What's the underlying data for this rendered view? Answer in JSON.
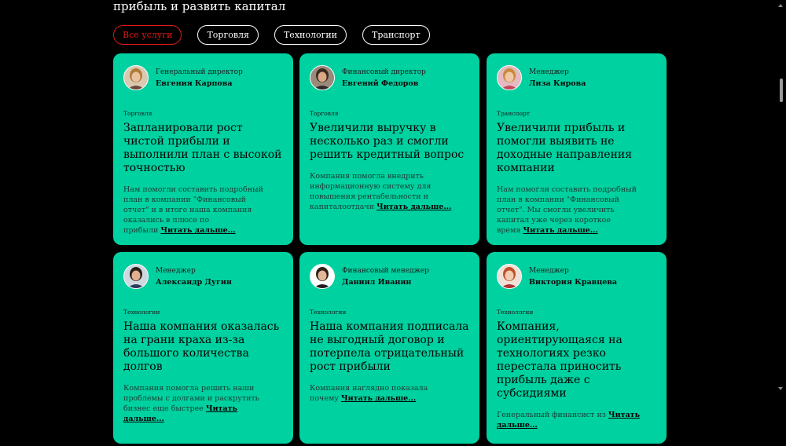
{
  "header": {
    "subtitle": "прибыль и развить капитал"
  },
  "filters": [
    {
      "label": "Все услуги",
      "active": true
    },
    {
      "label": "Торговля",
      "active": false
    },
    {
      "label": "Технологии",
      "active": false
    },
    {
      "label": "Транспорт",
      "active": false
    }
  ],
  "read_more": "Читать дальше...",
  "cards": [
    {
      "role": "Генеральный директор",
      "name": "Евгения Карпова",
      "category": "Торговля",
      "title": "Запланировали рост чистой прибыли и выполнили план с высокой точностью",
      "text": "Нам помогли составить подробный план в компании \"Финансовый отчет\" и в итоге наша компания оказались в плюсе по прибыли",
      "avatar": {
        "hair": "#b07a3a",
        "skin": "#e8c2a0",
        "shirt": "#6a4b3a",
        "bg": "#d9c9b0"
      }
    },
    {
      "role": "Финансовый директор",
      "name": "Евгений Федоров",
      "category": "Торговля",
      "title": "Увеличили выручку в несколько раз и смогли решить кредитный вопрос",
      "text": "Компания помогла внедрить информационную систему для повышения рентабельности и капиталоотдачи",
      "avatar": {
        "hair": "#3b2a1e",
        "skin": "#d9a886",
        "shirt": "#2b2b2b",
        "bg": "#9a8a7a"
      }
    },
    {
      "role": "Менеджер",
      "name": "Лиза Кирова",
      "category": "Транспорт",
      "title": "Увеличили прибыль и помогли выявить не доходные направления компании",
      "text": "Нам помогли составить подробный план в компании \"Финансовый отчет\". Мы смогли увеличить капитал уже через короткое время",
      "avatar": {
        "hair": "#c98a3a",
        "skin": "#f0c8a8",
        "shirt": "#c04a5a",
        "bg": "#e6b8c0"
      }
    },
    {
      "role": "Менеджер",
      "name": "Александр Дугин",
      "category": "Технологии",
      "title": "Наша компания оказалась на грани краха из-за большого количества долгов",
      "text": "Компания помогла решить наши проблемы с долгами и раскрутить бизнес еще быстрее",
      "avatar": {
        "hair": "#2a2018",
        "skin": "#e0b090",
        "shirt": "#2a3a5a",
        "bg": "#cfd8e0"
      }
    },
    {
      "role": "Финансовый менеджер",
      "name": "Даниил Иванин",
      "category": "Технологии",
      "title": "Наша компания подписала не выгодный договор и потерпела отрицательный рост прибыли",
      "text": "Компания наглядно показала почему",
      "avatar": {
        "hair": "#2e2218",
        "skin": "#e2b898",
        "shirt": "#1e1e1e",
        "bg": "#ffffff"
      }
    },
    {
      "role": "Менеджер",
      "name": "Виктория Кравцева",
      "category": "Технологии",
      "title": "Компания, ориентирующаяся на технологиях резко перестала приносить прибыль даже с субсидиями",
      "text": "Генеральный финансист из",
      "avatar": {
        "hair": "#c0502a",
        "skin": "#f2ccb0",
        "shirt": "#b03030",
        "bg": "#f0e0d8"
      }
    }
  ]
}
